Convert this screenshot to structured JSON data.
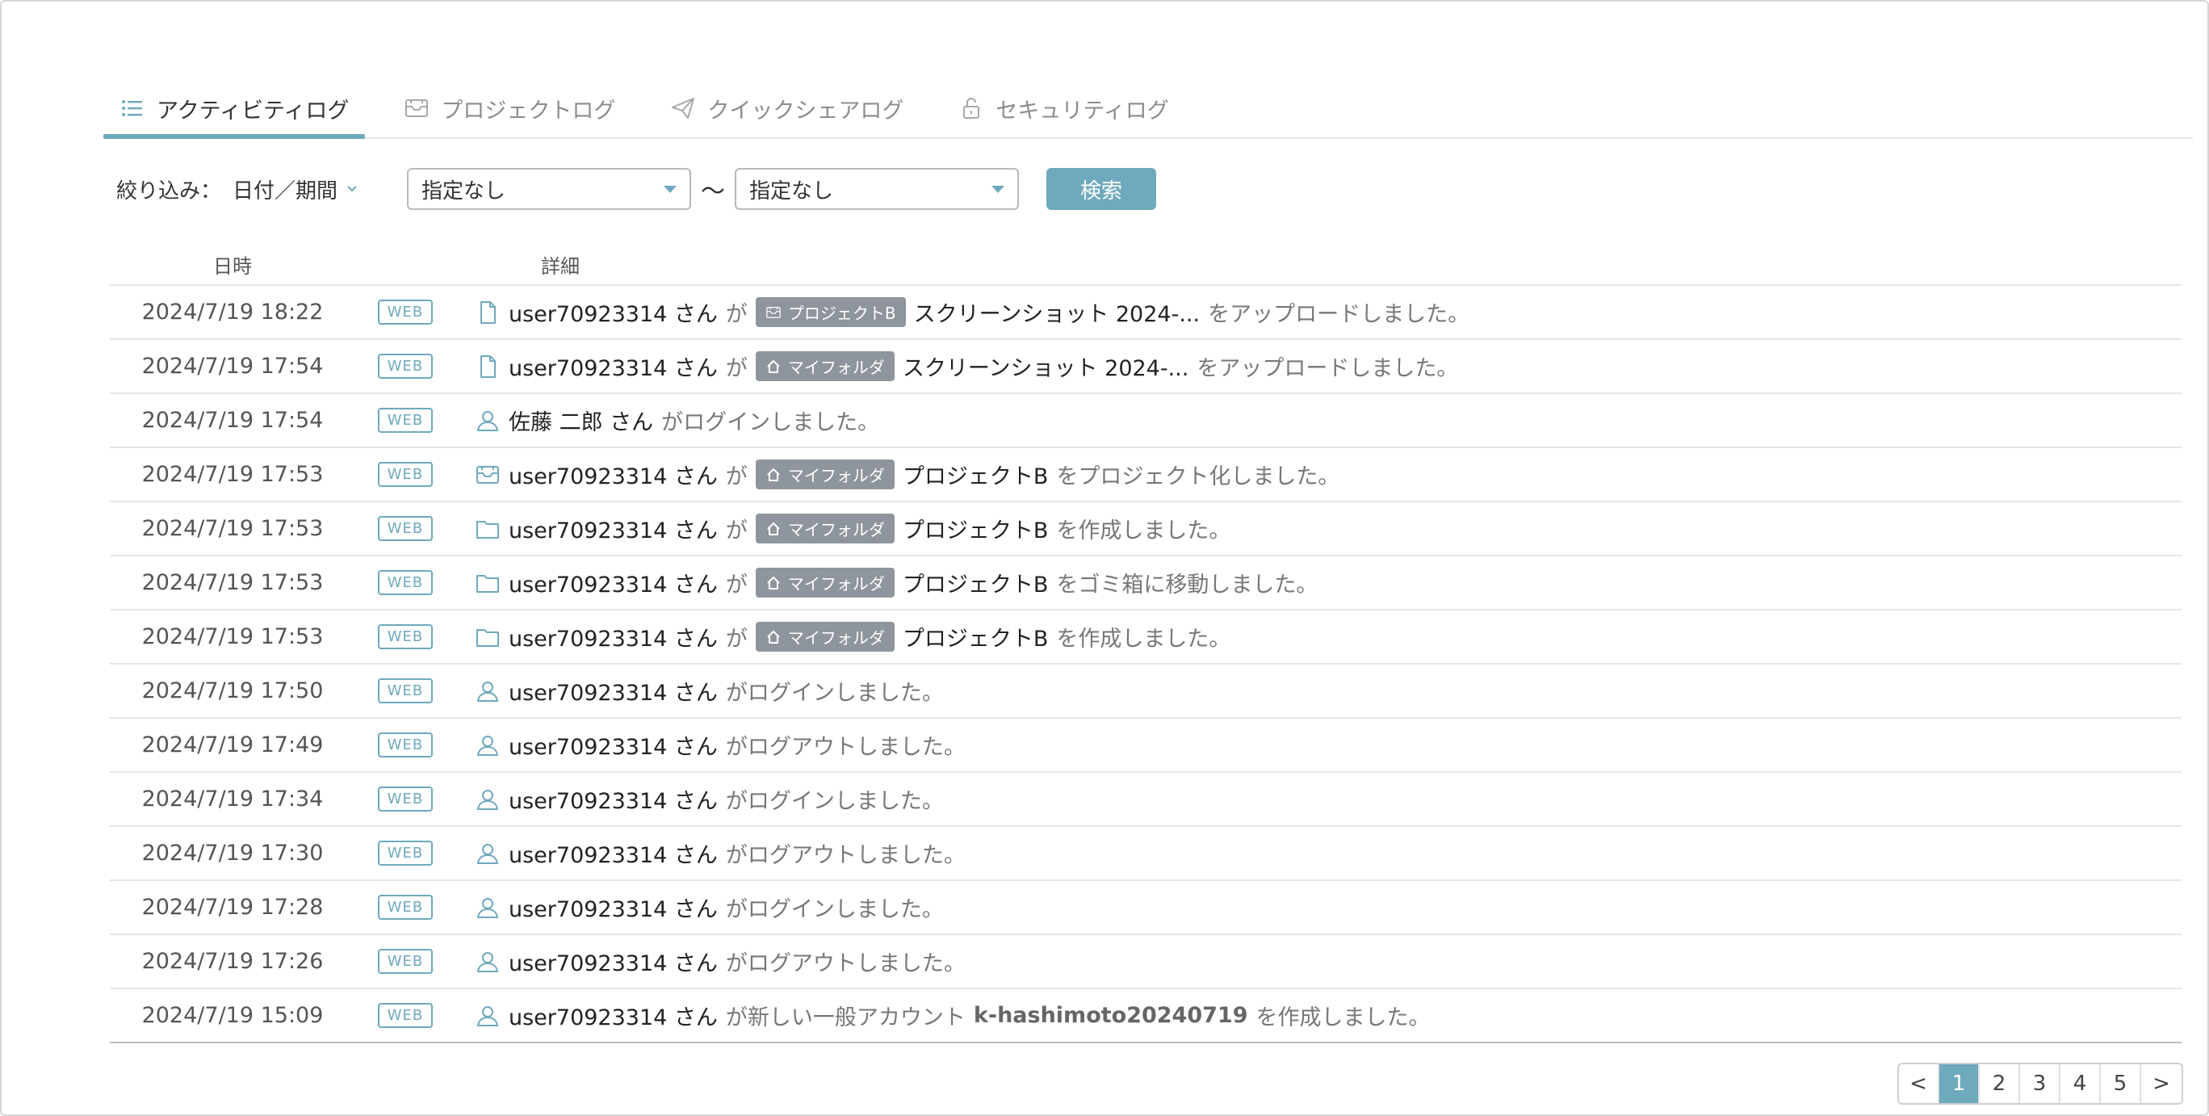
{
  "tabs": [
    {
      "label": "アクティビティログ",
      "icon": "list-icon",
      "active": true
    },
    {
      "label": "プロジェクトログ",
      "icon": "project-box-icon",
      "active": false
    },
    {
      "label": "クイックシェアログ",
      "icon": "paper-plane-icon",
      "active": false
    },
    {
      "label": "セキュリティログ",
      "icon": "lock-icon",
      "active": false
    }
  ],
  "filter": {
    "label": "絞り込み：",
    "type": "日付／期間",
    "from": "指定なし",
    "tilde": "～",
    "to": "指定なし",
    "search_label": "検索"
  },
  "table": {
    "headers": {
      "date": "日時",
      "detail": "詳細"
    },
    "web_label": "WEB",
    "rows": [
      {
        "date": "2024/7/19 18:22",
        "icon": "file-icon",
        "user": "user70923314 さん",
        "ga": "が",
        "badge": "プロジェクトB",
        "badge_icon": "project-box-icon",
        "target": "スクリーンショット 2024-...",
        "action": "をアップロードしました。"
      },
      {
        "date": "2024/7/19 17:54",
        "icon": "file-icon",
        "user": "user70923314 さん",
        "ga": "が",
        "badge": "マイフォルダ",
        "badge_icon": "home-icon",
        "target": "スクリーンショット 2024-...",
        "action": "をアップロードしました。"
      },
      {
        "date": "2024/7/19 17:54",
        "icon": "user-icon",
        "user": "佐藤 二郎 さん",
        "ga": "",
        "badge": "",
        "target": "",
        "action": "がログインしました。"
      },
      {
        "date": "2024/7/19 17:53",
        "icon": "project-box-icon",
        "user": "user70923314 さん",
        "ga": "が",
        "badge": "マイフォルダ",
        "badge_icon": "home-icon",
        "target": "プロジェクトB",
        "action": "をプロジェクト化しました。"
      },
      {
        "date": "2024/7/19 17:53",
        "icon": "folder-icon",
        "user": "user70923314 さん",
        "ga": "が",
        "badge": "マイフォルダ",
        "badge_icon": "home-icon",
        "target": "プロジェクトB",
        "action": "を作成しました。"
      },
      {
        "date": "2024/7/19 17:53",
        "icon": "folder-icon",
        "user": "user70923314 さん",
        "ga": "が",
        "badge": "マイフォルダ",
        "badge_icon": "home-icon",
        "target": "プロジェクトB",
        "action": "をゴミ箱に移動しました。"
      },
      {
        "date": "2024/7/19 17:53",
        "icon": "folder-icon",
        "user": "user70923314 さん",
        "ga": "が",
        "badge": "マイフォルダ",
        "badge_icon": "home-icon",
        "target": "プロジェクトB",
        "action": "を作成しました。"
      },
      {
        "date": "2024/7/19 17:50",
        "icon": "user-icon",
        "user": "user70923314 さん",
        "ga": "",
        "badge": "",
        "target": "",
        "action": "がログインしました。"
      },
      {
        "date": "2024/7/19 17:49",
        "icon": "user-icon",
        "user": "user70923314 さん",
        "ga": "",
        "badge": "",
        "target": "",
        "action": "がログアウトしました。"
      },
      {
        "date": "2024/7/19 17:34",
        "icon": "user-icon",
        "user": "user70923314 さん",
        "ga": "",
        "badge": "",
        "target": "",
        "action": "がログインしました。"
      },
      {
        "date": "2024/7/19 17:30",
        "icon": "user-icon",
        "user": "user70923314 さん",
        "ga": "",
        "badge": "",
        "target": "",
        "action": "がログアウトしました。"
      },
      {
        "date": "2024/7/19 17:28",
        "icon": "user-icon",
        "user": "user70923314 さん",
        "ga": "",
        "badge": "",
        "target": "",
        "action": "がログインしました。"
      },
      {
        "date": "2024/7/19 17:26",
        "icon": "user-icon",
        "user": "user70923314 さん",
        "ga": "",
        "badge": "",
        "target": "",
        "action": "がログアウトしました。"
      },
      {
        "date": "2024/7/19 15:09",
        "icon": "user-icon",
        "user": "user70923314 さん",
        "ga": "",
        "badge": "",
        "target": "",
        "action": "が新しい一般アカウント",
        "account": "k-hashimoto20240719",
        "action2": "を作成しました。"
      }
    ]
  },
  "pagination": {
    "prev": "<",
    "pages": [
      "1",
      "2",
      "3",
      "4",
      "5"
    ],
    "current": "1",
    "next": ">"
  },
  "colors": {
    "accent": "#6fa9bd",
    "badge_bg": "#8f959d"
  }
}
